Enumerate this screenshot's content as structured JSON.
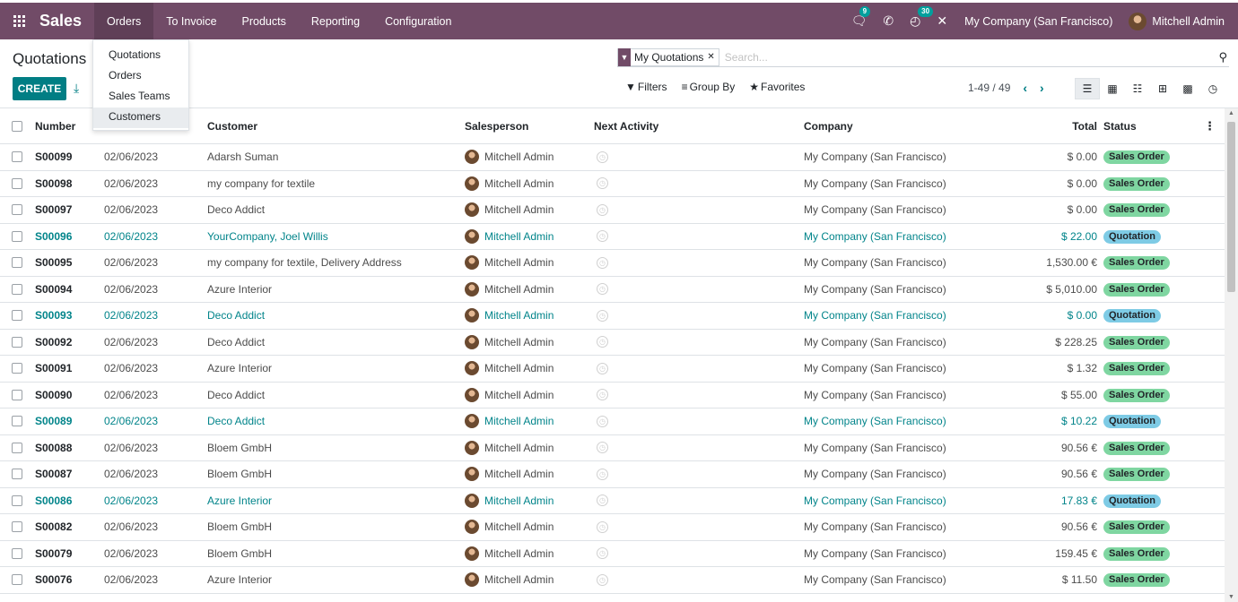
{
  "app": {
    "name": "Sales"
  },
  "nav": {
    "items": [
      "Orders",
      "To Invoice",
      "Products",
      "Reporting",
      "Configuration"
    ],
    "chat_count": "9",
    "calls_count": "30",
    "company": "My Company (San Francisco)",
    "user": "Mitchell Admin"
  },
  "orders_menu": [
    "Quotations",
    "Orders",
    "Sales Teams",
    "Customers"
  ],
  "control": {
    "title": "Quotations",
    "create_label": "CREATE",
    "facet": "My Quotations",
    "search_placeholder": "Search...",
    "filters": "Filters",
    "group_by": "Group By",
    "favorites": "Favorites",
    "pager": "1-49 / 49"
  },
  "columns": {
    "number": "Number",
    "customer": "Customer",
    "salesperson": "Salesperson",
    "next_activity": "Next Activity",
    "company": "Company",
    "total": "Total",
    "status": "Status"
  },
  "rows": [
    {
      "number": "S00099",
      "date": "02/06/2023",
      "customer": "Adarsh Suman",
      "salesperson": "Mitchell Admin",
      "company": "My Company (San Francisco)",
      "total": "$ 0.00",
      "status": "Sales Order",
      "quotation": false
    },
    {
      "number": "S00098",
      "date": "02/06/2023",
      "customer": "my company for textile",
      "salesperson": "Mitchell Admin",
      "company": "My Company (San Francisco)",
      "total": "$ 0.00",
      "status": "Sales Order",
      "quotation": false
    },
    {
      "number": "S00097",
      "date": "02/06/2023",
      "customer": "Deco Addict",
      "salesperson": "Mitchell Admin",
      "company": "My Company (San Francisco)",
      "total": "$ 0.00",
      "status": "Sales Order",
      "quotation": false
    },
    {
      "number": "S00096",
      "date": "02/06/2023",
      "customer": "YourCompany, Joel Willis",
      "salesperson": "Mitchell Admin",
      "company": "My Company (San Francisco)",
      "total": "$ 22.00",
      "status": "Quotation",
      "quotation": true
    },
    {
      "number": "S00095",
      "date": "02/06/2023",
      "customer": "my company for textile, Delivery Address",
      "salesperson": "Mitchell Admin",
      "company": "My Company (San Francisco)",
      "total": "1,530.00 €",
      "status": "Sales Order",
      "quotation": false
    },
    {
      "number": "S00094",
      "date": "02/06/2023",
      "customer": "Azure Interior",
      "salesperson": "Mitchell Admin",
      "company": "My Company (San Francisco)",
      "total": "$ 5,010.00",
      "status": "Sales Order",
      "quotation": false
    },
    {
      "number": "S00093",
      "date": "02/06/2023",
      "customer": "Deco Addict",
      "salesperson": "Mitchell Admin",
      "company": "My Company (San Francisco)",
      "total": "$ 0.00",
      "status": "Quotation",
      "quotation": true
    },
    {
      "number": "S00092",
      "date": "02/06/2023",
      "customer": "Deco Addict",
      "salesperson": "Mitchell Admin",
      "company": "My Company (San Francisco)",
      "total": "$ 228.25",
      "status": "Sales Order",
      "quotation": false
    },
    {
      "number": "S00091",
      "date": "02/06/2023",
      "customer": "Azure Interior",
      "salesperson": "Mitchell Admin",
      "company": "My Company (San Francisco)",
      "total": "$ 1.32",
      "status": "Sales Order",
      "quotation": false
    },
    {
      "number": "S00090",
      "date": "02/06/2023",
      "customer": "Deco Addict",
      "salesperson": "Mitchell Admin",
      "company": "My Company (San Francisco)",
      "total": "$ 55.00",
      "status": "Sales Order",
      "quotation": false
    },
    {
      "number": "S00089",
      "date": "02/06/2023",
      "customer": "Deco Addict",
      "salesperson": "Mitchell Admin",
      "company": "My Company (San Francisco)",
      "total": "$ 10.22",
      "status": "Quotation",
      "quotation": true
    },
    {
      "number": "S00088",
      "date": "02/06/2023",
      "customer": "Bloem GmbH",
      "salesperson": "Mitchell Admin",
      "company": "My Company (San Francisco)",
      "total": "90.56 €",
      "status": "Sales Order",
      "quotation": false
    },
    {
      "number": "S00087",
      "date": "02/06/2023",
      "customer": "Bloem GmbH",
      "salesperson": "Mitchell Admin",
      "company": "My Company (San Francisco)",
      "total": "90.56 €",
      "status": "Sales Order",
      "quotation": false
    },
    {
      "number": "S00086",
      "date": "02/06/2023",
      "customer": "Azure Interior",
      "salesperson": "Mitchell Admin",
      "company": "My Company (San Francisco)",
      "total": "17.83 €",
      "status": "Quotation",
      "quotation": true
    },
    {
      "number": "S00082",
      "date": "02/06/2023",
      "customer": "Bloem GmbH",
      "salesperson": "Mitchell Admin",
      "company": "My Company (San Francisco)",
      "total": "90.56 €",
      "status": "Sales Order",
      "quotation": false
    },
    {
      "number": "S00079",
      "date": "02/06/2023",
      "customer": "Bloem GmbH",
      "salesperson": "Mitchell Admin",
      "company": "My Company (San Francisco)",
      "total": "159.45 €",
      "status": "Sales Order",
      "quotation": false
    },
    {
      "number": "S00076",
      "date": "02/06/2023",
      "customer": "Azure Interior",
      "salesperson": "Mitchell Admin",
      "company": "My Company (San Francisco)",
      "total": "$ 11.50",
      "status": "Sales Order",
      "quotation": false
    }
  ]
}
